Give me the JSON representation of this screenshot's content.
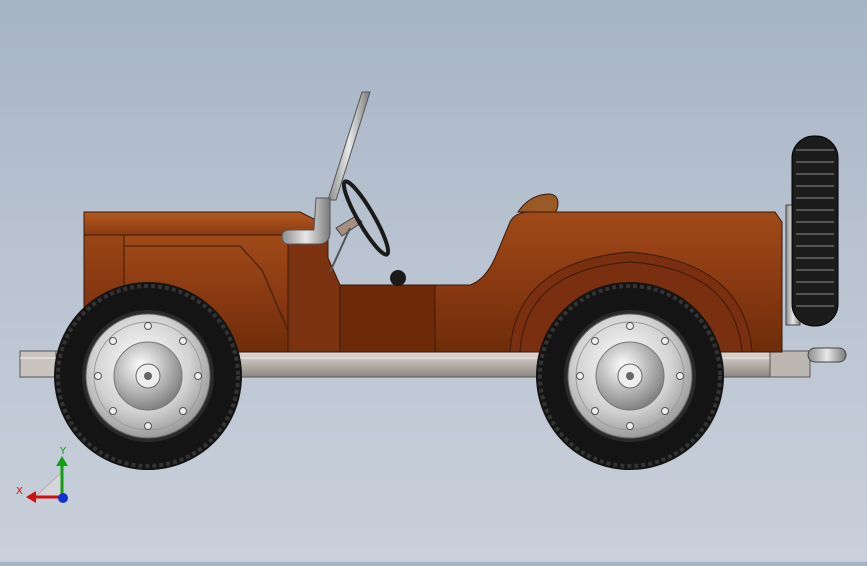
{
  "viewport": {
    "background_top": "#a7b4c6",
    "background_bottom": "#c9d0db"
  },
  "model": {
    "body_color": "#8a3a12",
    "body_shadow": "#6a2a08",
    "frame_color": "#c8c2bc",
    "tire_color": "#1a1a1a",
    "rim_color": "#d4d4d4"
  },
  "triad": {
    "x_label": "X",
    "y_label": "Y",
    "x_color": "#d01010",
    "y_color": "#10a010",
    "z_color": "#1030d0"
  }
}
